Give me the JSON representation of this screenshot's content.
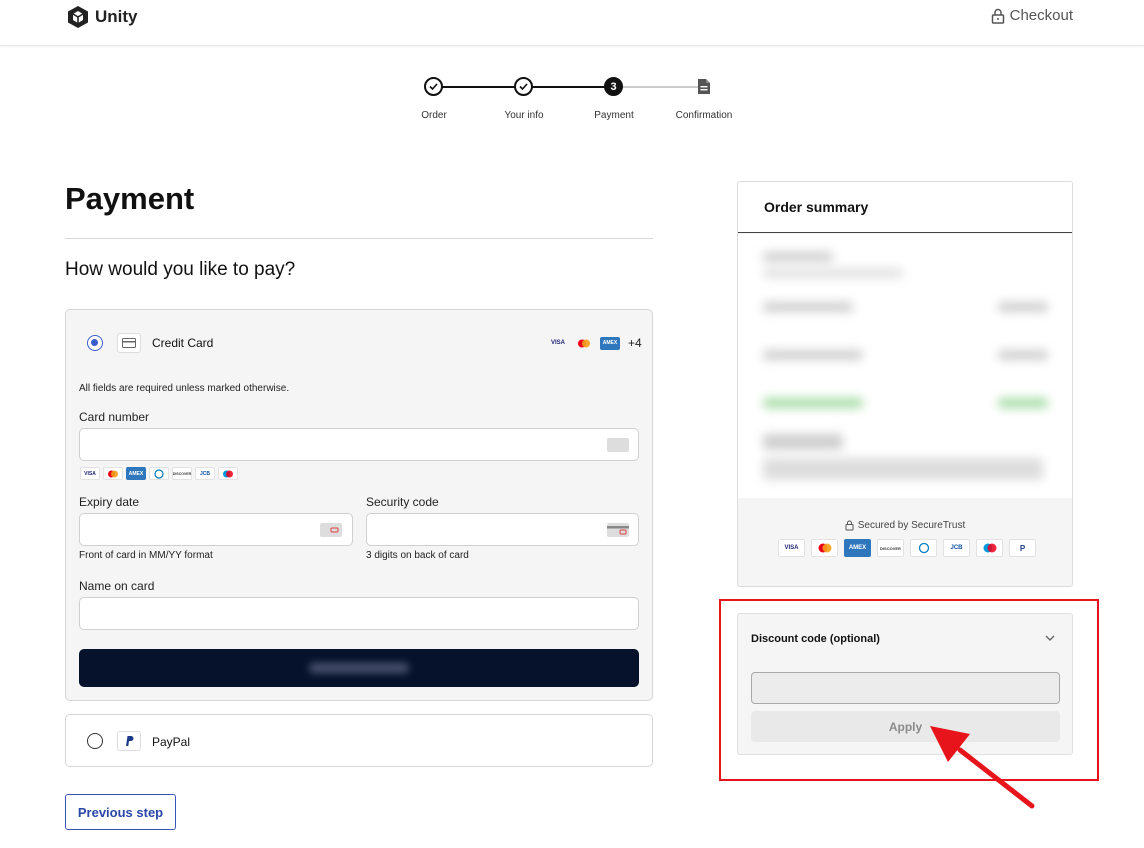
{
  "header": {
    "logo_text": "Unity",
    "checkout_label": "Checkout"
  },
  "stepper": {
    "steps": [
      {
        "label": "Order",
        "state": "done"
      },
      {
        "label": "Your info",
        "state": "done"
      },
      {
        "label": "Payment",
        "state": "active",
        "number": "3"
      },
      {
        "label": "Confirmation",
        "state": "pending"
      }
    ]
  },
  "main": {
    "title": "Payment",
    "subtitle": "How would you like to pay?",
    "credit_card": {
      "label": "Credit Card",
      "more_brands": "+4",
      "header_brands": [
        "VISA",
        "MC",
        "AMEX"
      ],
      "required_note": "All fields are required unless marked otherwise.",
      "card_number_label": "Card number",
      "card_number_value": "",
      "field_brands": [
        "VISA",
        "MC",
        "AMEX",
        "DINERS",
        "DISCOVER",
        "JCB",
        "MAESTRO"
      ],
      "expiry_label": "Expiry date",
      "expiry_value": "",
      "expiry_hint": "Front of card in MM/YY format",
      "security_label": "Security code",
      "security_value": "",
      "security_hint": "3 digits on back of card",
      "name_label": "Name on card",
      "name_value": ""
    },
    "paypal": {
      "label": "PayPal"
    },
    "previous_step_label": "Previous step"
  },
  "summary": {
    "title": "Order summary",
    "secured_text": "Secured by SecureTrust",
    "brands": [
      "VISA",
      "MC",
      "AMEX",
      "DISCOVER",
      "DINERS",
      "JCB",
      "MAESTRO",
      "P"
    ]
  },
  "discount": {
    "title": "Discount code (optional)",
    "input_value": "",
    "apply_label": "Apply"
  },
  "colors": {
    "accent": "#3a5ccc",
    "pay_button": "#06122b",
    "highlight": "#e8141b"
  }
}
